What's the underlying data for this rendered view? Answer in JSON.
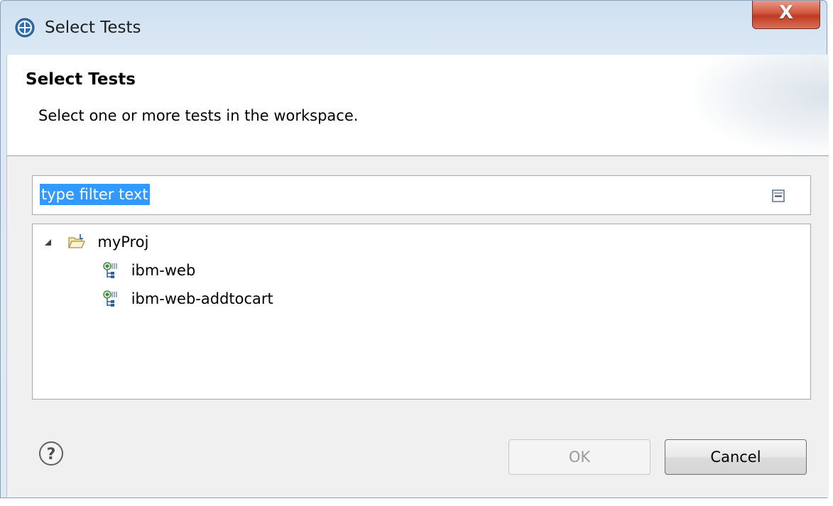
{
  "window": {
    "title": "Select Tests",
    "close_label": "X"
  },
  "header": {
    "title": "Select Tests",
    "description": "Select one or more tests in the workspace."
  },
  "filter": {
    "value": "type filter text",
    "collapse_icon": "collapse-all-icon"
  },
  "tree": {
    "project": {
      "label": "myProj",
      "icon": "open-folder-icon",
      "expanded": true
    },
    "tests": [
      {
        "label": "ibm-web",
        "icon": "test-schedule-icon"
      },
      {
        "label": "ibm-web-addtocart",
        "icon": "test-schedule-icon"
      }
    ]
  },
  "footer": {
    "help_icon": "help-icon",
    "ok_label": "OK",
    "cancel_label": "Cancel",
    "ok_enabled": false
  },
  "colors": {
    "selection": "#3399ff",
    "close_button": "#c8452d"
  }
}
